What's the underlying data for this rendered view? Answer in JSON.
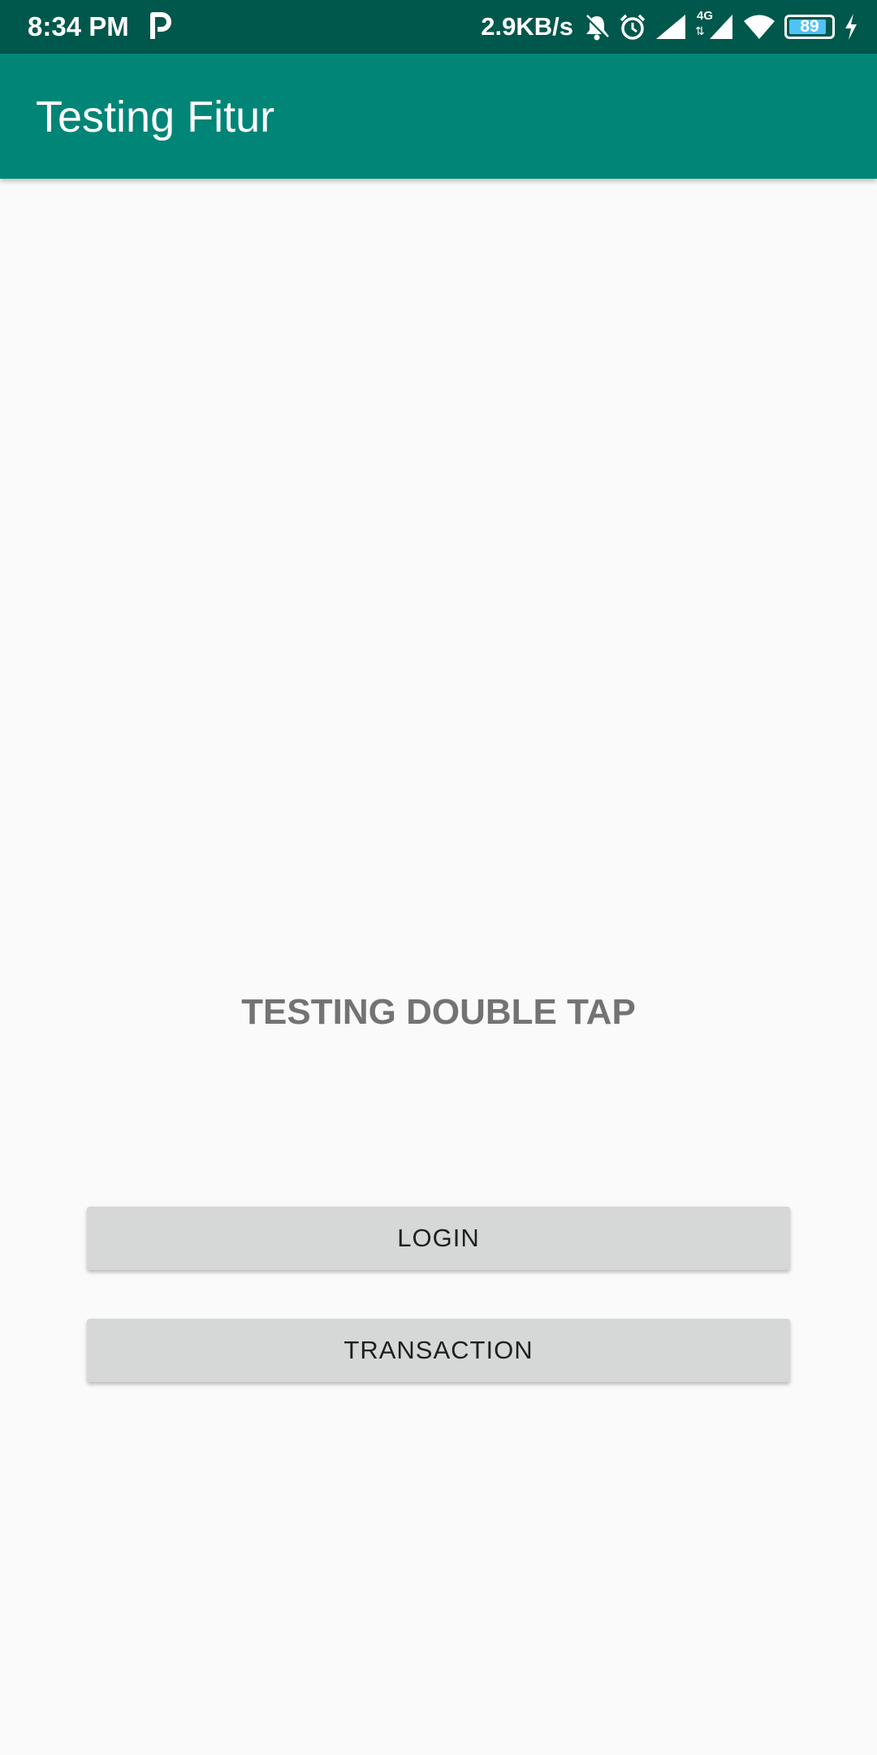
{
  "status_bar": {
    "time": "8:34 PM",
    "net_speed": "2.9KB/s",
    "network_type": "4G",
    "battery_level": "89",
    "battery_fraction": 0.89,
    "icons": [
      "parking-p-icon",
      "bell-muted-icon",
      "alarm-icon",
      "signal-icon",
      "signal-4g-icon",
      "wifi-icon",
      "battery-icon",
      "charging-icon"
    ],
    "colors": {
      "background": "#00574b",
      "battery_fill": "#4fc3f7"
    }
  },
  "app_bar": {
    "title": "Testing Fitur",
    "color": "#008577"
  },
  "main": {
    "heading": "TESTING DOUBLE TAP",
    "buttons": [
      {
        "label": "LOGIN"
      },
      {
        "label": "TRANSACTION"
      }
    ]
  }
}
